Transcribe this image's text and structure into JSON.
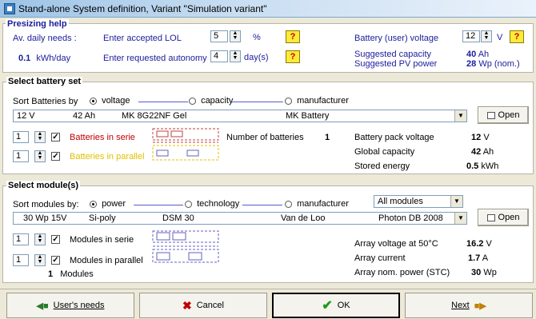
{
  "title": "Stand-alone System definition, Variant  \"Simulation variant\"",
  "presizing": {
    "legend": "Presizing help",
    "av_daily_label": "Av. daily needs :",
    "av_daily_value": "0.1",
    "av_daily_unit": "kWh/day",
    "lol_label": "Enter accepted LOL",
    "lol_value": "5",
    "lol_unit": "%",
    "autonomy_label": "Enter requested autonomy",
    "autonomy_value": "4",
    "autonomy_unit": "day(s)",
    "help_label": "?",
    "battery_voltage_label": "Battery (user) voltage",
    "battery_voltage_value": "12",
    "battery_voltage_unit": "V",
    "sugg_capacity_label": "Suggested capacity",
    "sugg_capacity_value": "40",
    "sugg_capacity_unit": "Ah",
    "sugg_pv_label": "Suggested PV power",
    "sugg_pv_value": "28",
    "sugg_pv_unit": "Wp (nom.)"
  },
  "battery": {
    "legend": "Select battery set",
    "sort_label": "Sort Batteries by",
    "sort_voltage": "voltage",
    "sort_capacity": "capacity",
    "sort_manufacturer": "manufacturer",
    "sel_voltage": "12 V",
    "sel_capacity": "42 Ah",
    "sel_model": "MK 8G22NF Gel",
    "sel_maker": "MK Battery",
    "open_label": "Open",
    "serie_value": "1",
    "serie_label": "Batteries in serie",
    "parallel_value": "1",
    "parallel_label": "Batteries in parallel",
    "num_label": "Number of batteries",
    "num_value": "1",
    "pack_voltage_label": "Battery pack voltage",
    "pack_voltage_value": "12",
    "pack_voltage_unit": "V",
    "global_cap_label": "Global capacity",
    "global_cap_value": "42",
    "global_cap_unit": "Ah",
    "stored_label": "Stored energy",
    "stored_value": "0.5",
    "stored_unit": "kWh"
  },
  "module": {
    "legend": "Select module(s)",
    "sort_label": "Sort modules by:",
    "sort_power": "power",
    "sort_technology": "technology",
    "sort_manufacturer": "manufacturer",
    "filter_value": "All modules",
    "sel_power": "30 Wp 15V",
    "sel_tech": "Si-poly",
    "sel_model": "DSM 30",
    "sel_maker": "Van de Loo",
    "sel_source": "Photon DB 2008",
    "open_label": "Open",
    "serie_value": "1",
    "serie_label": "Modules in serie",
    "parallel_value": "1",
    "parallel_label": "Modules in parallel",
    "count_value": "1",
    "count_label": "Modules",
    "array_voltage_label": "Array voltage at 50°C",
    "array_voltage_value": "16.2",
    "array_voltage_unit": "V",
    "array_current_label": "Array current",
    "array_current_value": "1.7",
    "array_current_unit": "A",
    "array_power_label": "Array nom. power (STC)",
    "array_power_value": "30",
    "array_power_unit": "Wp"
  },
  "footer": {
    "users_needs": "User's needs",
    "cancel": "Cancel",
    "ok": "OK",
    "next": "Next"
  },
  "colors": {
    "title_gradient": "#9cc3e6",
    "label_blue": "#1c1c9c",
    "serie_red": "#c00000",
    "parallel_yellow": "#e0c000",
    "help_yellow": "#ffea3a"
  }
}
